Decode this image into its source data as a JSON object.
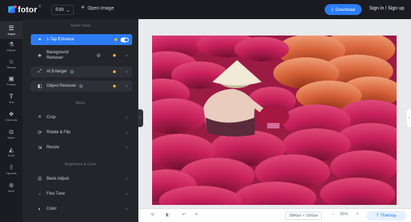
{
  "topbar": {
    "logo_text": "fotor",
    "logo_sup": "®",
    "edit_label": "Edit",
    "open_image": "Open Image",
    "download": "Download",
    "signin": "Sign in / Sign up"
  },
  "rail": {
    "items": [
      {
        "label": "Adjust",
        "icon": "sliders-icon"
      },
      {
        "label": "Effects",
        "icon": "flask-icon"
      },
      {
        "label": "Beauty",
        "icon": "face-icon"
      },
      {
        "label": "Frames",
        "icon": "frame-icon"
      },
      {
        "label": "Text",
        "icon": "text-icon"
      },
      {
        "label": "Elements",
        "icon": "shapes-icon"
      },
      {
        "label": "Batch",
        "icon": "batch-icon"
      },
      {
        "label": "AI Art",
        "icon": "ai-icon"
      },
      {
        "label": "Uploads",
        "icon": "upload-icon"
      },
      {
        "label": "More",
        "icon": "more-icon"
      }
    ]
  },
  "panel": {
    "smart_tools_title": "Smart Tools",
    "basic_title": "Basic",
    "brightness_title": "Brightness & Color",
    "tools": {
      "enhance": "1-Tap Enhance",
      "bg_remover_1": "Background",
      "bg_remover_2": "Remover",
      "ai_enlarger": "AI Enlarger",
      "object_remover": "Object Remover",
      "crop": "Crop",
      "rotate_flip": "Rotate & Flip",
      "resize": "Resize",
      "basic_adjust": "Basic Adjust",
      "fine_tune": "Fine Tune",
      "color": "Color"
    }
  },
  "bottombar": {
    "dimensions": "2880px × 1500px",
    "zoom": "35%",
    "help": "Помощь"
  },
  "colors": {
    "accent": "#2c7cf6",
    "pro_dot": "#f5b72a",
    "dark_bg": "#1b1c21"
  }
}
